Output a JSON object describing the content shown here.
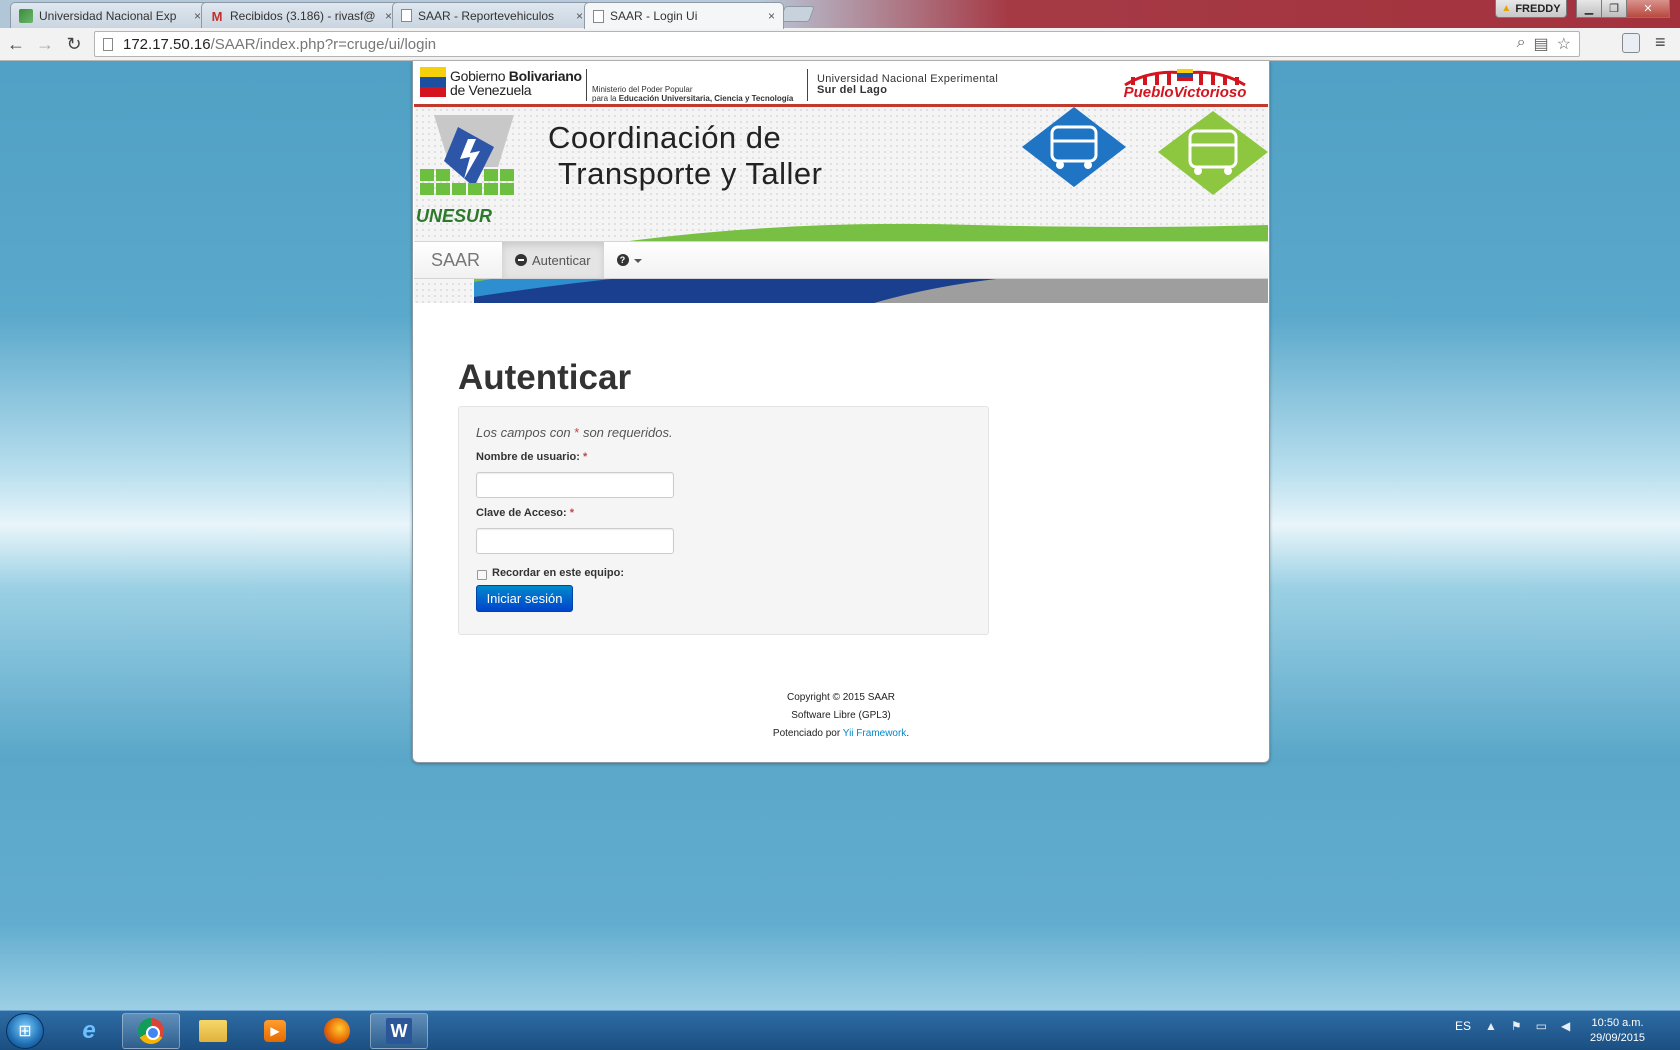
{
  "browser": {
    "tabs": [
      {
        "title": "Universidad Nacional Exp",
        "favicon": "unesur-favicon-icon",
        "active": false
      },
      {
        "title": "Recibidos (3.186) - rivasf@",
        "favicon": "gmail-icon",
        "active": false
      },
      {
        "title": "SAAR - Reportevehiculos",
        "favicon": "page-icon",
        "active": false
      },
      {
        "title": "SAAR - Login Ui",
        "favicon": "page-icon",
        "active": true
      }
    ],
    "tab_close": "×",
    "user_name": "FREDDY",
    "url_host": "172.17.50.16",
    "url_path": "/SAAR/index.php?r=cruge/ui/login"
  },
  "header": {
    "gov_line1_prefix": "Gobierno ",
    "gov_line1_bold": "Bolivariano",
    "gov_line2": "de Venezuela",
    "ministerio_line1": "Ministerio del Poder Popular",
    "ministerio_line2_prefix": "para la ",
    "ministerio_line2_bold": "Educación Universitaria, Ciencia y Tecnología",
    "unesur_line1": "Universidad Nacional Experimental",
    "unesur_line2": "Sur del Lago",
    "pueblo_logo_text": "PuebloVictorioso",
    "banner_line1": "Coordinación de",
    "banner_line2": "Transporte y Taller",
    "unesur_logo_text": "UNESUR"
  },
  "navbar": {
    "brand": "SAAR",
    "login_item": "Autenticar"
  },
  "content": {
    "title": "Autenticar",
    "note_prefix": "Los campos con ",
    "note_star": "*",
    "note_suffix": " son requeridos.",
    "username_label": "Nombre de usuario:",
    "password_label": "Clave de Acceso:",
    "required_star": "*",
    "username_value": "",
    "password_value": "",
    "remember_label": "Recordar en este equipo:",
    "submit_label": "Iniciar sesión"
  },
  "footer": {
    "copyright": "Copyright © 2015 SAAR",
    "license": "Software Libre (GPL3)",
    "powered_prefix": "Potenciado por ",
    "powered_link": "Yii Framework",
    "powered_suffix": "."
  },
  "taskbar": {
    "language": "ES",
    "time": "10:50 a.m.",
    "date": "29/09/2015"
  },
  "colors": {
    "accent_button": "#0066cc",
    "required": "#b94a48",
    "link": "#0088cc"
  }
}
